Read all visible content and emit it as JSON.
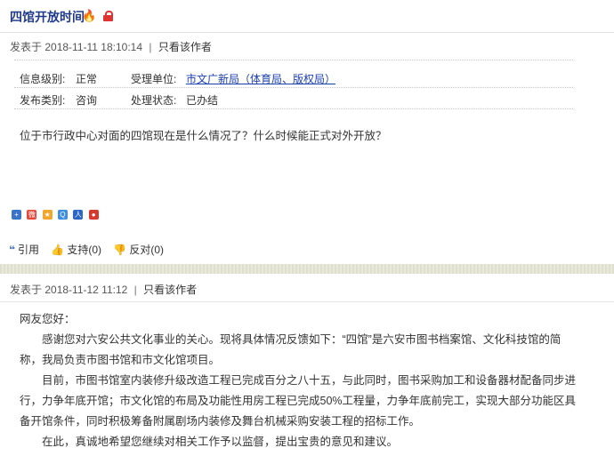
{
  "header": {
    "title": "四馆开放时间",
    "fire_icon": "fire-icon",
    "lock_icon": "lock-icon"
  },
  "post": {
    "published_prefix": "发表于",
    "datetime": "2018-11-11 18:10:14",
    "separator": "|",
    "author_only": "只看该作者",
    "info": {
      "level_label": "信息级别:",
      "level_value": "正常",
      "unit_label": "受理单位:",
      "unit_value": "市文广新局（体育局、版权局）",
      "category_label": "发布类别:",
      "category_value": "咨询",
      "status_label": "处理状态:",
      "status_value": "已办结"
    },
    "question": "位于市行政中心对面的四馆现在是什么情况了？什么时候能正式对外开放？",
    "actions": {
      "quote": "引用",
      "support": "支持(0)",
      "oppose": "反对(0)"
    }
  },
  "reply": {
    "published_prefix": "发表于",
    "datetime": "2018-11-12 11:12",
    "separator": "|",
    "author_only": "只看该作者",
    "greeting": "网友您好：",
    "para1": "感谢您对六安公共文化事业的关心。现将具体情况反馈如下：“四馆”是六安市图书档案馆、文化科技馆的简称，我局负责市图书馆和市文化馆项目。",
    "para2": "目前，市图书馆室内装修升级改造工程已完成百分之八十五，与此同时，图书采购加工和设备器材配备同步进行，力争年底开馆；市文化馆的布局及功能性用房工程已完成50%工程量，力争年底前完工，实现大部分功能区具备开馆条件，同时积极筹备附属剧场内装修及舞台机械采购安装工程的招标工作。",
    "para3": "在此，真诚地希望您继续对相关工作予以监督，提出宝贵的意见和建议。"
  },
  "watermark": "@"
}
